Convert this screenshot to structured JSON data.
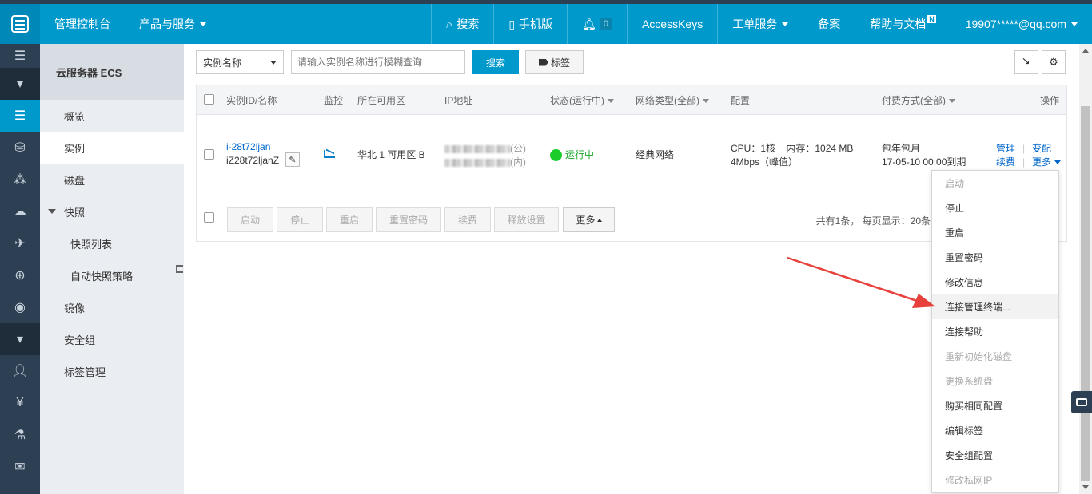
{
  "topbar": {
    "console": "管理控制台",
    "products": "产品与服务",
    "search": "搜索",
    "mobile": "手机版",
    "notifications_count": "0",
    "accesskeys": "AccessKeys",
    "tickets": "工单服务",
    "beian": "备案",
    "help": "帮助与文档",
    "help_badge": "N",
    "account": "19907*****@qq.com"
  },
  "subnav": {
    "title": "云服务器 ECS",
    "items": [
      "概览",
      "实例",
      "磁盘",
      "快照",
      "快照列表",
      "自动快照策略",
      "镜像",
      "安全组",
      "标签管理"
    ]
  },
  "toolbar": {
    "filter_select": "实例名称",
    "search_placeholder": "请输入实例名称进行模糊查询",
    "search_button": "搜索",
    "tag_button": "标签"
  },
  "table": {
    "headers": {
      "id_name": "实例ID/名称",
      "monitor": "监控",
      "zone": "所在可用区",
      "ip": "IP地址",
      "status": "状态(运行中)",
      "network": "网络类型(全部)",
      "config": "配置",
      "billing": "付费方式(全部)",
      "actions": "操作"
    },
    "row": {
      "instance_id": "i-28t72ljan",
      "instance_name": "iZ28t72ljanZ",
      "zone": "华北 1 可用区 B",
      "ip_public_suffix": "(公)",
      "ip_private_suffix": "(内)",
      "status": "运行中",
      "network": "经典网络",
      "config_line1": "CPU：1核    内存：1024 MB",
      "config_line2": "4Mbps（峰值）",
      "billing_line1": "包年包月",
      "billing_line2": "17-05-10 00:00到期",
      "action_manage": "管理",
      "action_upgrade": "变配",
      "action_renew": "续费",
      "action_more": "更多"
    }
  },
  "footer": {
    "buttons": [
      "启动",
      "停止",
      "重启",
      "重置密码",
      "续费",
      "释放设置",
      "更多"
    ],
    "pager": "共有1条， 每页显示：20条"
  },
  "dropdown": {
    "items": [
      {
        "label": "启动",
        "disabled": true
      },
      {
        "label": "停止",
        "disabled": false
      },
      {
        "label": "重启",
        "disabled": false
      },
      {
        "label": "重置密码",
        "disabled": false
      },
      {
        "label": "修改信息",
        "disabled": false
      },
      {
        "label": "连接管理终端...",
        "disabled": false
      },
      {
        "label": "连接帮助",
        "disabled": false
      },
      {
        "label": "重新初始化磁盘",
        "disabled": true
      },
      {
        "label": "更换系统盘",
        "disabled": true
      },
      {
        "label": "购买相同配置",
        "disabled": false
      },
      {
        "label": "编辑标签",
        "disabled": false
      },
      {
        "label": "安全组配置",
        "disabled": false
      },
      {
        "label": "修改私网IP",
        "disabled": true
      }
    ]
  },
  "colors": {
    "topbar": "#0099cc",
    "iconbar": "#2d3f52",
    "status_green": "#1bcc2b",
    "arrow": "#e8413c"
  },
  "icons": {
    "iconbar": [
      "menu-icon",
      "collapse-icon",
      "server-icon",
      "database-icon",
      "network-icon",
      "cloud-upload-icon",
      "cdn-icon",
      "globe-icon",
      "dns-icon",
      "collapse-icon",
      "user-icon",
      "yuan-icon",
      "flask-icon",
      "mail-icon"
    ]
  }
}
